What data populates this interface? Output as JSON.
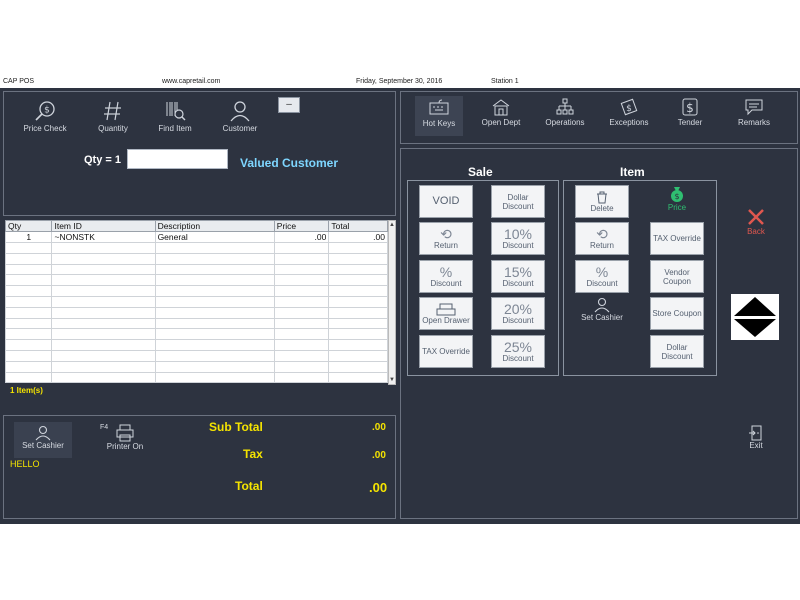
{
  "titlebar": {
    "app": "CAP POS",
    "website": "www.capretail.com",
    "date": "Friday, September 30, 2016",
    "station": "Station 1"
  },
  "left_toolbar": [
    {
      "label": "Price Check",
      "icon": "price-check-icon"
    },
    {
      "label": "Quantity",
      "icon": "hash-icon"
    },
    {
      "label": "Find Item",
      "icon": "barcode-search-icon"
    },
    {
      "label": "Customer",
      "icon": "customer-icon"
    }
  ],
  "qty": {
    "label": "Qty = 1",
    "value": "",
    "customer": "Valued Customer",
    "minus": "–"
  },
  "grid": {
    "columns": [
      "Qty",
      "Item ID",
      "Description",
      "Price",
      "Total"
    ],
    "rows": [
      [
        "1",
        "~NONSTK",
        "General",
        ".00",
        ".00"
      ]
    ],
    "item_count": "1  Item(s)"
  },
  "bottom_left": {
    "set_cashier": "Set Cashier",
    "cashier_name": "HELLO",
    "printer_key": "F4",
    "printer": "Printer On",
    "subtotal_label": "Sub Total",
    "subtotal_value": ".00",
    "tax_label": "Tax",
    "tax_value": ".00",
    "total_label": "Total",
    "total_value": ".00"
  },
  "right_tabs": [
    {
      "label": "Hot Keys",
      "icon": "keyboard-icon",
      "active": true
    },
    {
      "label": "Open Dept",
      "icon": "building-icon",
      "active": false
    },
    {
      "label": "Operations",
      "icon": "org-chart-icon",
      "active": false
    },
    {
      "label": "Exceptions",
      "icon": "exceptions-icon",
      "active": false
    },
    {
      "label": "Tender",
      "icon": "dollar-icon",
      "active": false
    },
    {
      "label": "Remarks",
      "icon": "comment-icon",
      "active": false
    }
  ],
  "sale": {
    "title": "Sale",
    "void": "VOID",
    "dollar_discount": "Dollar Discount",
    "return": "Return",
    "discount": "Discount",
    "open_drawer": "Open Drawer",
    "tax_override": "TAX Override",
    "pct10": "10%",
    "pct15": "15%",
    "pct20": "20%",
    "pct25": "25%",
    "pct_discount": "Discount",
    "pct_symbol": "%"
  },
  "item": {
    "title": "Item",
    "delete": "Delete",
    "price": "Price",
    "return": "Return",
    "tax_override": "TAX Override",
    "discount": "Discount",
    "pct_symbol": "%",
    "vendor_coupon": "Vendor Coupon",
    "set_cashier": "Set Cashier",
    "store_coupon": "Store Coupon",
    "dollar_discount": "Dollar Discount"
  },
  "side": {
    "back": "Back",
    "exit": "Exit"
  },
  "colors": {
    "background": "#2d3340",
    "yellow": "#f5e400",
    "cyan": "#7ed6ff",
    "back_red": "#e0574f",
    "price_green": "#2fbf71"
  }
}
